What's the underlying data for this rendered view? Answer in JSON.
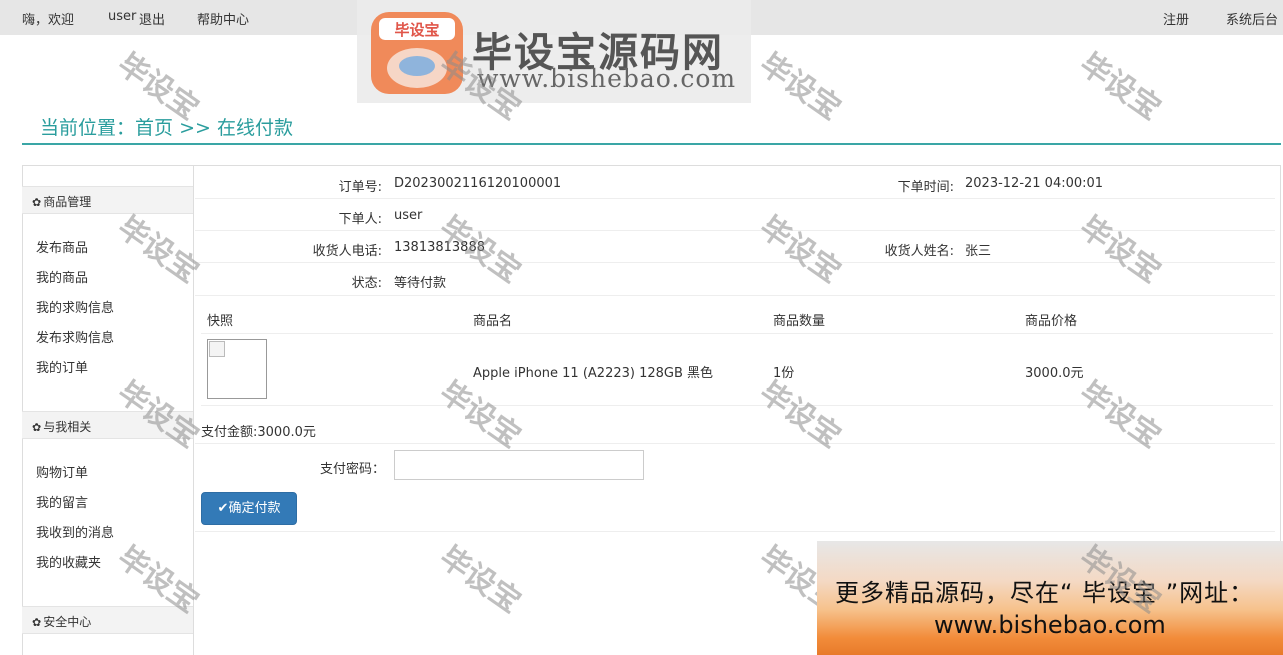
{
  "topbar": {
    "greeting": "嗨，欢迎",
    "user": "user",
    "logout": "退出",
    "help": "帮助中心",
    "register": "注册",
    "admin": "系统后台"
  },
  "logo": {
    "badge": "毕设宝",
    "title": "毕设宝源码网",
    "url": "www.bishebao.com"
  },
  "breadcrumb": {
    "prefix": "当前位置：",
    "home": "首页",
    "sep": ">>",
    "current": "在线付款"
  },
  "sidebar": {
    "groups": [
      {
        "title": "商品管理",
        "items": [
          "发布商品",
          "我的商品",
          "我的求购信息",
          "发布求购信息",
          "我的订单"
        ]
      },
      {
        "title": "与我相关",
        "items": [
          "购物订单",
          "我的留言",
          "我收到的消息",
          "我的收藏夹"
        ]
      },
      {
        "title": "安全中心",
        "items": []
      }
    ]
  },
  "order": {
    "order_no_label": "订单号:",
    "order_no": "D2023002116120100001",
    "time_label": "下单时间:",
    "time": "2023-12-21 04:00:01",
    "buyer_label": "下单人:",
    "buyer": "user",
    "phone_label": "收货人电话:",
    "phone": "13813813888",
    "receiver_label": "收货人姓名:",
    "receiver": "张三",
    "status_label": "状态:",
    "status": "等待付款"
  },
  "goods_table": {
    "headers": [
      "快照",
      "商品名",
      "商品数量",
      "商品价格"
    ],
    "rows": [
      {
        "name": "Apple iPhone 11 (A2223) 128GB 黑色",
        "qty": "1份",
        "price": "3000.0元"
      }
    ]
  },
  "payment": {
    "total": "支付金额:3000.0元",
    "password_label": "支付密码：",
    "password_value": "",
    "confirm": "确定付款"
  },
  "watermark": "毕设宝",
  "promo": {
    "line1": "更多精品源码，尽在“ 毕设宝 ”网址：",
    "line2": "www.bishebao.com"
  },
  "colors": {
    "accent": "#3aa6a6",
    "button": "#337ab7"
  }
}
